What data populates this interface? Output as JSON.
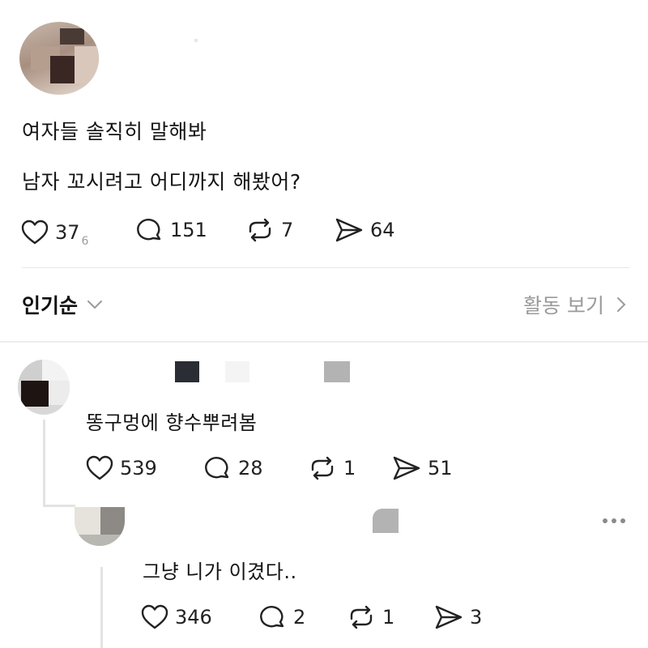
{
  "post": {
    "line1": "여자들 솔직히 말해봐",
    "line2": "남자 꼬시려고 어디까지 해봤어?",
    "likes": "37",
    "likes_sub": "6",
    "comments": "151",
    "reposts": "7",
    "shares": "64"
  },
  "controls": {
    "sort_label": "인기순",
    "activity_label": "활동 보기"
  },
  "reply1": {
    "text": "똥구멍에 향수뿌려봄",
    "likes": "539",
    "comments": "28",
    "reposts": "1",
    "shares": "51"
  },
  "reply2": {
    "text": "그냥 니가 이겼다..",
    "likes": "346",
    "comments": "2",
    "reposts": "1",
    "shares": "3"
  },
  "icons": [
    "heart-icon",
    "comment-icon",
    "repost-icon",
    "send-icon",
    "chevron-down-icon",
    "chevron-right-icon",
    "more-icon"
  ]
}
